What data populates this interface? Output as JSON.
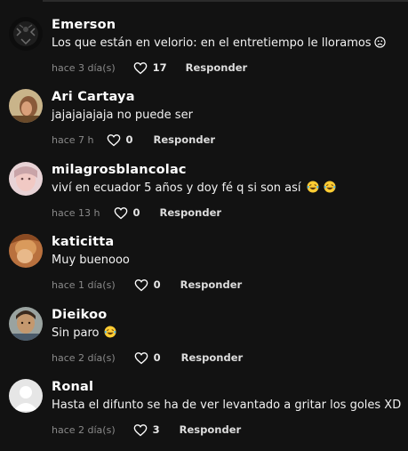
{
  "icons": {
    "like": "heart-outline-icon",
    "laugh": "tears-of-joy-emoji-icon",
    "sad": "sad-face-emoji-icon"
  },
  "colors": {
    "background": "#121212",
    "text": "#ffffff",
    "muted": "#8a8a8a",
    "laugh_emoji": "#ffcc33"
  },
  "comments": [
    {
      "username": "Emerson",
      "text": "Los que están en velorio: en el entretiempo le lloramos",
      "time": "hace 3 día(s)",
      "likes": "17",
      "reply": "Responder"
    },
    {
      "username": "Ari Cartaya",
      "text": "jajajajajaja no puede ser",
      "time": "hace 7 h",
      "likes": "0",
      "reply": "Responder"
    },
    {
      "username": "milagrosblancolac",
      "text": "viví en ecuador 5 años y doy fé q si son así",
      "time": "hace 13 h",
      "likes": "0",
      "reply": "Responder"
    },
    {
      "username": "katicitta",
      "text": "Muy buenooo",
      "time": "hace 1 día(s)",
      "likes": "0",
      "reply": "Responder"
    },
    {
      "username": "Dieikoo",
      "text": "Sin paro",
      "time": "hace 2 día(s)",
      "likes": "0",
      "reply": "Responder"
    },
    {
      "username": "Ronal",
      "text": "Hasta el difunto se ha de ver levantado a gritar los goles XD",
      "time": "hace 2 día(s)",
      "likes": "3",
      "reply": "Responder"
    }
  ]
}
